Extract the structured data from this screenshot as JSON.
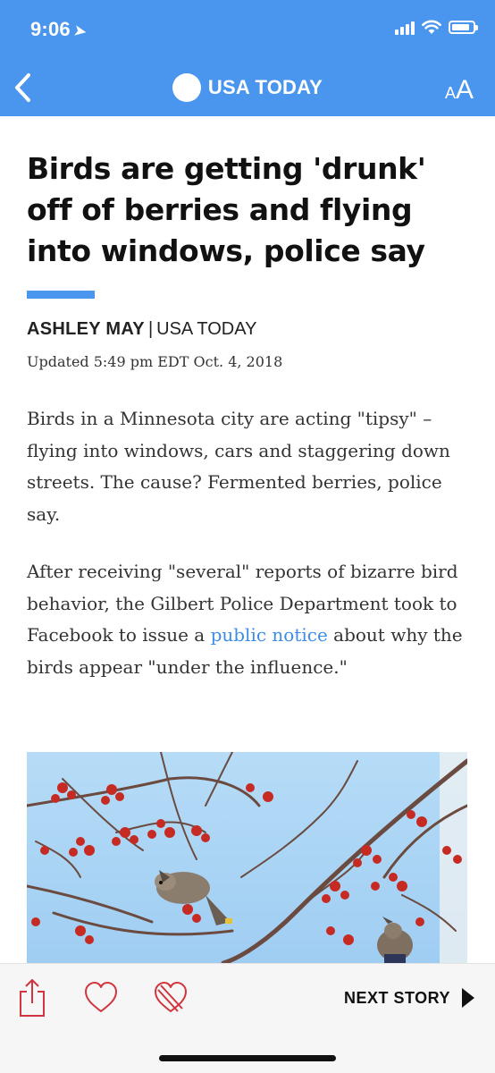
{
  "status_bar": {
    "time": "9:06",
    "location_glyph": "➤",
    "icons": [
      "location-arrow-icon",
      "cellular-signal-icon",
      "wifi-icon",
      "battery-icon"
    ],
    "battery_level": 0.85
  },
  "nav": {
    "brand": "USA TODAY",
    "text_size_small": "A",
    "text_size_large": "A",
    "back_icon": "chevron-left-icon",
    "accent_color": "#4a95ee"
  },
  "article": {
    "headline": "Birds are getting 'drunk' off of berries and flying into windows, police say",
    "author": "ASHLEY MAY",
    "byline_separator": "|",
    "publication": "USA TODAY",
    "updated": "Updated 5:49 pm EDT Oct. 4, 2018",
    "paragraph1": "Birds in a Minnesota city are acting \"tipsy\" – flying into windows, cars and staggering down streets. The cause? Fermented berries, police say.",
    "paragraph2_before": "After receiving \"several\" reports of bizarre bird behavior, the Gilbert Police Department took to Facebook to issue a ",
    "paragraph2_link": "public notice",
    "paragraph2_after": " about why the birds appear \"under the influence.\"",
    "link_color": "#3d8de8"
  },
  "toolbar": {
    "share_icon": "share-icon",
    "like_icon": "heart-icon",
    "dislike_icon": "heart-crossed-icon",
    "next_label": "NEXT STORY",
    "next_icon": "play-triangle-icon",
    "icon_color": "#d0343d"
  }
}
